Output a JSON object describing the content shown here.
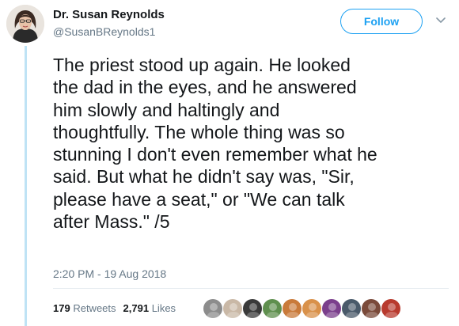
{
  "author": {
    "name": "Dr. Susan Reynolds",
    "handle": "@SusanBReynolds1",
    "follow_label": "Follow"
  },
  "tweet": {
    "lines": [
      "The priest stood up again. He looked",
      "the dad in the eyes, and he answered",
      "him slowly and haltingly and",
      "thoughtfully. The whole thing was so",
      "stunning I don't even remember what he",
      "said. But what he didn't say was, \"Sir,",
      "please have a seat,\" or \"We can talk",
      "after Mass.\" /5"
    ],
    "timestamp": "2:20 PM - 19 Aug 2018"
  },
  "stats": {
    "retweets_count": "179",
    "retweets_label": "Retweets",
    "likes_count": "2,791",
    "likes_label": "Likes"
  },
  "likers": [
    {
      "name": "liker-avatar-1",
      "color": "#8c8c8c"
    },
    {
      "name": "liker-avatar-2",
      "color": "#c9b8a6"
    },
    {
      "name": "liker-avatar-3",
      "color": "#3a3a3a"
    },
    {
      "name": "liker-avatar-4",
      "color": "#5f8f4e"
    },
    {
      "name": "liker-avatar-5",
      "color": "#c97a3a"
    },
    {
      "name": "liker-avatar-6",
      "color": "#d9914a"
    },
    {
      "name": "liker-avatar-7",
      "color": "#7b3f8c"
    },
    {
      "name": "liker-avatar-8",
      "color": "#4a5a6a"
    },
    {
      "name": "liker-avatar-9",
      "color": "#7a4a3a"
    },
    {
      "name": "liker-avatar-10",
      "color": "#b83a2e"
    }
  ],
  "colors": {
    "accent": "#1da1f2",
    "thread_line": "#bfe3f5",
    "secondary_text": "#657786"
  },
  "icons": {
    "more": "chevron-down-icon"
  }
}
